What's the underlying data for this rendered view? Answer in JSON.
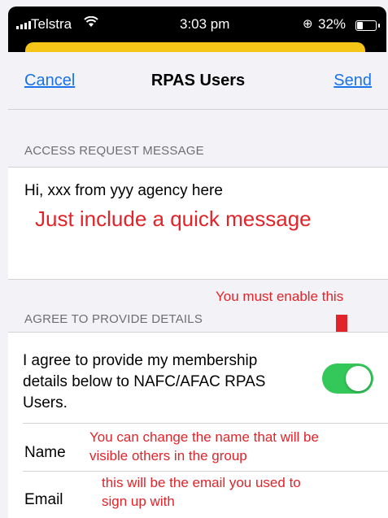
{
  "status_bar": {
    "carrier": "Telstra",
    "time": "3:03 pm",
    "battery": "32%",
    "battery_level": 0.32,
    "signal_icon": "signal-bars-icon",
    "wifi_icon": "wifi-icon",
    "location_icon": "rotation-lock-icon"
  },
  "nav": {
    "cancel": "Cancel",
    "title": "RPAS Users",
    "send": "Send"
  },
  "access_request": {
    "header": "ACCESS REQUEST MESSAGE",
    "message": "Hi, xxx from yyy agency here"
  },
  "agree": {
    "header": "AGREE TO PROVIDE DETAILS",
    "text": "I agree to provide my membership details below to NAFC/AFAC RPAS Users.",
    "toggle_on": true
  },
  "fields": {
    "name_label": "Name",
    "email_label": "Email"
  },
  "annotations": {
    "quick_message": "Just include a quick message",
    "must_enable": "You must enable this",
    "name_note_1": "You  can change the name that will be",
    "name_note_2": "visible others in the group",
    "email_note_1": "this will be the email you used to",
    "email_note_2": "sign up with"
  },
  "colors": {
    "link_blue": "#1a73e8",
    "toggle_green": "#34c759",
    "annotation_red": "#e0242a",
    "banner_yellow": "#f5c518"
  }
}
